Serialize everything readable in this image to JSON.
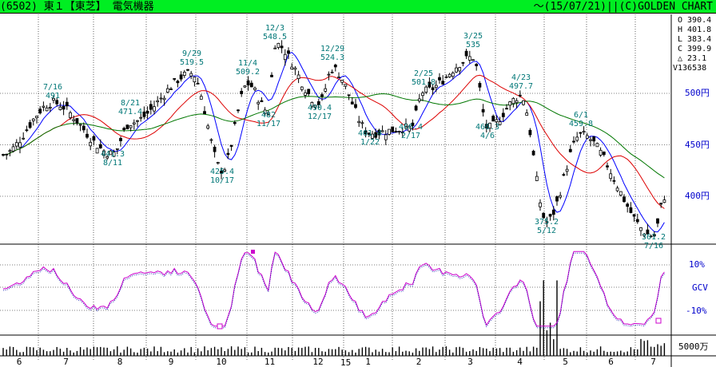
{
  "header": {
    "title": "(6502) 東１【東芝】 電気機器",
    "right": "～(15/07/21)||(C)GOLDEN CHART"
  },
  "ohlc_panel": {
    "open": "O 390.4",
    "high": "H 401.8",
    "low": "L 383.4",
    "close": "C 399.9",
    "change": "△ 23.1",
    "volume": "V136538"
  },
  "price_axis": [
    "500円",
    "450円",
    "400円"
  ],
  "osc_axis": {
    "top": "10%",
    "mid": "GCV",
    "bottom": "-10%"
  },
  "vol_axis": "5000万",
  "year_marker": "15",
  "month_labels": [
    "6",
    "7",
    "8",
    "9",
    "10",
    "11",
    "12",
    "1",
    "2",
    "3",
    "4",
    "5",
    "6",
    "7"
  ],
  "annotations": [
    {
      "date": "7/16",
      "price": "491"
    },
    {
      "date": "8/21",
      "price": "471.4"
    },
    {
      "date": "9/29",
      "price": "519.5"
    },
    {
      "date": "11/4",
      "price": "509.2"
    },
    {
      "date": "12/3",
      "price": "548.5"
    },
    {
      "date": "12/29",
      "price": "524.3"
    },
    {
      "date": "2/25",
      "price": "501.8"
    },
    {
      "date": "3/25",
      "price": "535"
    },
    {
      "date": "4/23",
      "price": "497.7"
    },
    {
      "date": "6/1",
      "price": "459.8"
    },
    {
      "date": "8/11",
      "price": "441.3"
    },
    {
      "date": "10/17",
      "price": "425.4"
    },
    {
      "date": "11/17",
      "price": "482"
    },
    {
      "date": "12/17",
      "price": "490.4"
    },
    {
      "date": "1/22",
      "price": "461.4"
    },
    {
      "date": "2/17",
      "price": "466.4"
    },
    {
      "date": "4/6",
      "price": "466.3"
    },
    {
      "date": "5/12",
      "price": "375.2"
    },
    {
      "date": "7/16",
      "price": "361.2"
    }
  ],
  "colors": {
    "header_bg": "#00ee22",
    "up_candle": "#ffffff",
    "down_candle": "#000000",
    "ma_short": "#0000ff",
    "ma_mid": "#dd0000",
    "ma_long": "#007700",
    "oscillator": "#cc00cc",
    "annotation_text": "#007777",
    "axis_text": "#0000cc"
  },
  "chart_data": {
    "type": "candlestick",
    "xlabel": "",
    "ylabel": "",
    "ylim": [
      355,
      555
    ],
    "unit": "円",
    "months": [
      "6",
      "7",
      "8",
      "9",
      "10",
      "11",
      "12",
      "1",
      "2",
      "3",
      "4",
      "5",
      "6",
      "7"
    ],
    "price_path": [
      [
        "start",
        440
      ],
      [
        "7/16",
        491
      ],
      [
        "8/11",
        441.3
      ],
      [
        "8/21",
        471.4
      ],
      [
        "9/29",
        519.5
      ],
      [
        "10/17",
        425.4
      ],
      [
        "11/4",
        509.2
      ],
      [
        "11/17",
        482
      ],
      [
        "12/3",
        548.5
      ],
      [
        "12/17",
        490.4
      ],
      [
        "12/29",
        524.3
      ],
      [
        "1/22",
        461.4
      ],
      [
        "2/17",
        466.4
      ],
      [
        "2/25",
        501.8
      ],
      [
        "3/25",
        535
      ],
      [
        "4/6",
        466.3
      ],
      [
        "4/23",
        497.7
      ],
      [
        "5/12",
        375.2
      ],
      [
        "6/1",
        459.8
      ],
      [
        "7/16",
        361.2
      ],
      [
        "7/21",
        399.9
      ]
    ],
    "oscillator": {
      "label": "GCV",
      "ylim": [
        -15,
        15
      ],
      "ticks": [
        "10%",
        "-10%"
      ]
    },
    "volume": {
      "unit": "5000万"
    }
  }
}
